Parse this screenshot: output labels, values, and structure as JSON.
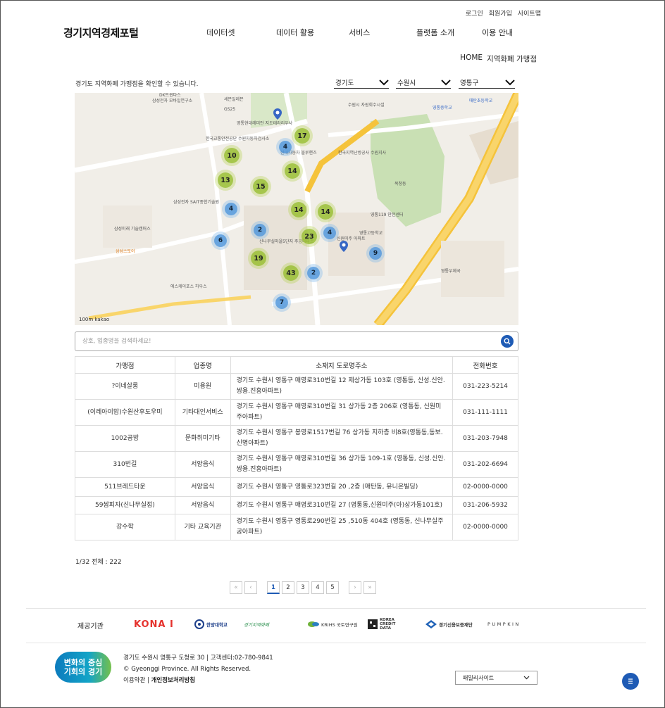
{
  "util": {
    "login": "로그인",
    "signup": "회원가입",
    "sitemap": "사이트맵"
  },
  "site_title": "경기지역경제포털",
  "gnb": [
    "데이터셋",
    "데이터 활용",
    "서비스",
    "플랫폼 소개",
    "이용 안내"
  ],
  "breadcrumb": {
    "home": "HOME",
    "current": "지역화폐 가맹점"
  },
  "intro": "경기도 지역화폐 가맹점을 확인할 수 있습니다.",
  "selects": {
    "province": "경기도",
    "city": "수원시",
    "district": "영통구"
  },
  "map": {
    "clusters_green": [
      "17",
      "10",
      "14",
      "13",
      "15",
      "14",
      "14",
      "23",
      "19",
      "43"
    ],
    "clusters_blue": [
      "4",
      "4",
      "2",
      "6",
      "4",
      "9",
      "2",
      "7"
    ],
    "labels": [
      "DK트윈타스",
      "삼성전자 모바일연구소",
      "세븐일레븐",
      "GS25",
      "영통현대레미안 지도테라리우사",
      "한국교통안전공단 수원자동차검사소",
      "현대자동차 블루핸즈",
      "한국지역난방공사 수원지사",
      "삼성전자 SAIT종합기술원",
      "삼성미래 기술캠퍼스",
      "신나무실마을5단지 주공아파트",
      "영통119 안전센터",
      "신원미주 아파트",
      "복청동",
      "영통고등학교",
      "수원시 자원회수시설",
      "삼성스토어",
      "에스케이포스 하우스",
      "영통중학교",
      "매탄초등학교",
      "영통우체국"
    ],
    "scale": "100m",
    "brand": "kakao"
  },
  "search": {
    "placeholder": "상호, 업종명을 검색하세요!"
  },
  "table": {
    "headers": [
      "가맹점",
      "업종명",
      "소재지 도로명주소",
      "전화번호"
    ],
    "rows": [
      [
        "?이네살롱",
        "미용원",
        "경기도 수원시 영통구 매영로310번길 12 제상가동 103호 (영통동, 신성.신안.쌍용.진흥아파트)",
        "031-223-5214"
      ],
      [
        "(이레아이맘)수원산후도우미",
        "기타대인서비스",
        "경기도 수원시 영통구 매영로310번길 31 상가동 2층 206호 (영통동, 신원미주아파트)",
        "031-111-1111"
      ],
      [
        "1002공방",
        "문화취미기타",
        "경기도 수원시 영통구 봉영로1517번길 76 상가동 지하층 비8호(영통동,동보.신명아파트)",
        "031-203-7948"
      ],
      [
        "310번길",
        "서양음식",
        "경기도 수원시 영통구 매영로310번길 36 상가동 109-1호 (영통동, 신성.신안.쌍용.진흥아파트)",
        "031-202-6694"
      ],
      [
        "511브레드타운",
        "서양음식",
        "경기도 수원시 영통구 영통로323번길 20 ,2층 (매탄동, 유니온빌딩)",
        "02-0000-0000"
      ],
      [
        "59쌈피자(신나무실점)",
        "서양음식",
        "경기도 수원시 영통구 매영로310번길 27 (영통동,신원미주(아)상가동101호)",
        "031-206-5932"
      ],
      [
        "강수학",
        "기타 교육기관",
        "경기도 수원시 영통구 영통로290번길 25 ,510동 404호 (영통동, 신나무실주공아파트)",
        "02-0000-0000"
      ]
    ]
  },
  "count": "1/32 전체 : 222",
  "pager": {
    "first": "«",
    "prev": "‹",
    "pages": [
      "1",
      "2",
      "3",
      "4",
      "5"
    ],
    "next": "›",
    "last": "»",
    "current": "1"
  },
  "partners": {
    "label": "제공기관",
    "items": [
      "KONA I",
      "한양대학교",
      "경기지역화폐",
      "KRIHS 국토연구원",
      "KOREA CREDIT DATA",
      "경기신용보증재단",
      "PUMPKIN"
    ]
  },
  "footer": {
    "slogan_line1": "변화의 중심",
    "slogan_line2": "기회의 경기",
    "address": "경기도 수원시 영통구 도청로 30 | 고객센터:02-780-9841",
    "copyright": "© Gyeonggi Province. All Rights Reserved.",
    "terms": "이용약관",
    "privacy": "개인정보처리방침",
    "family_site": "패밀리사이트"
  },
  "colors": {
    "accent": "#1e5bb5",
    "cluster_green": "#99be31",
    "cluster_blue": "#5096dc",
    "kona_red": "#e5322d"
  }
}
